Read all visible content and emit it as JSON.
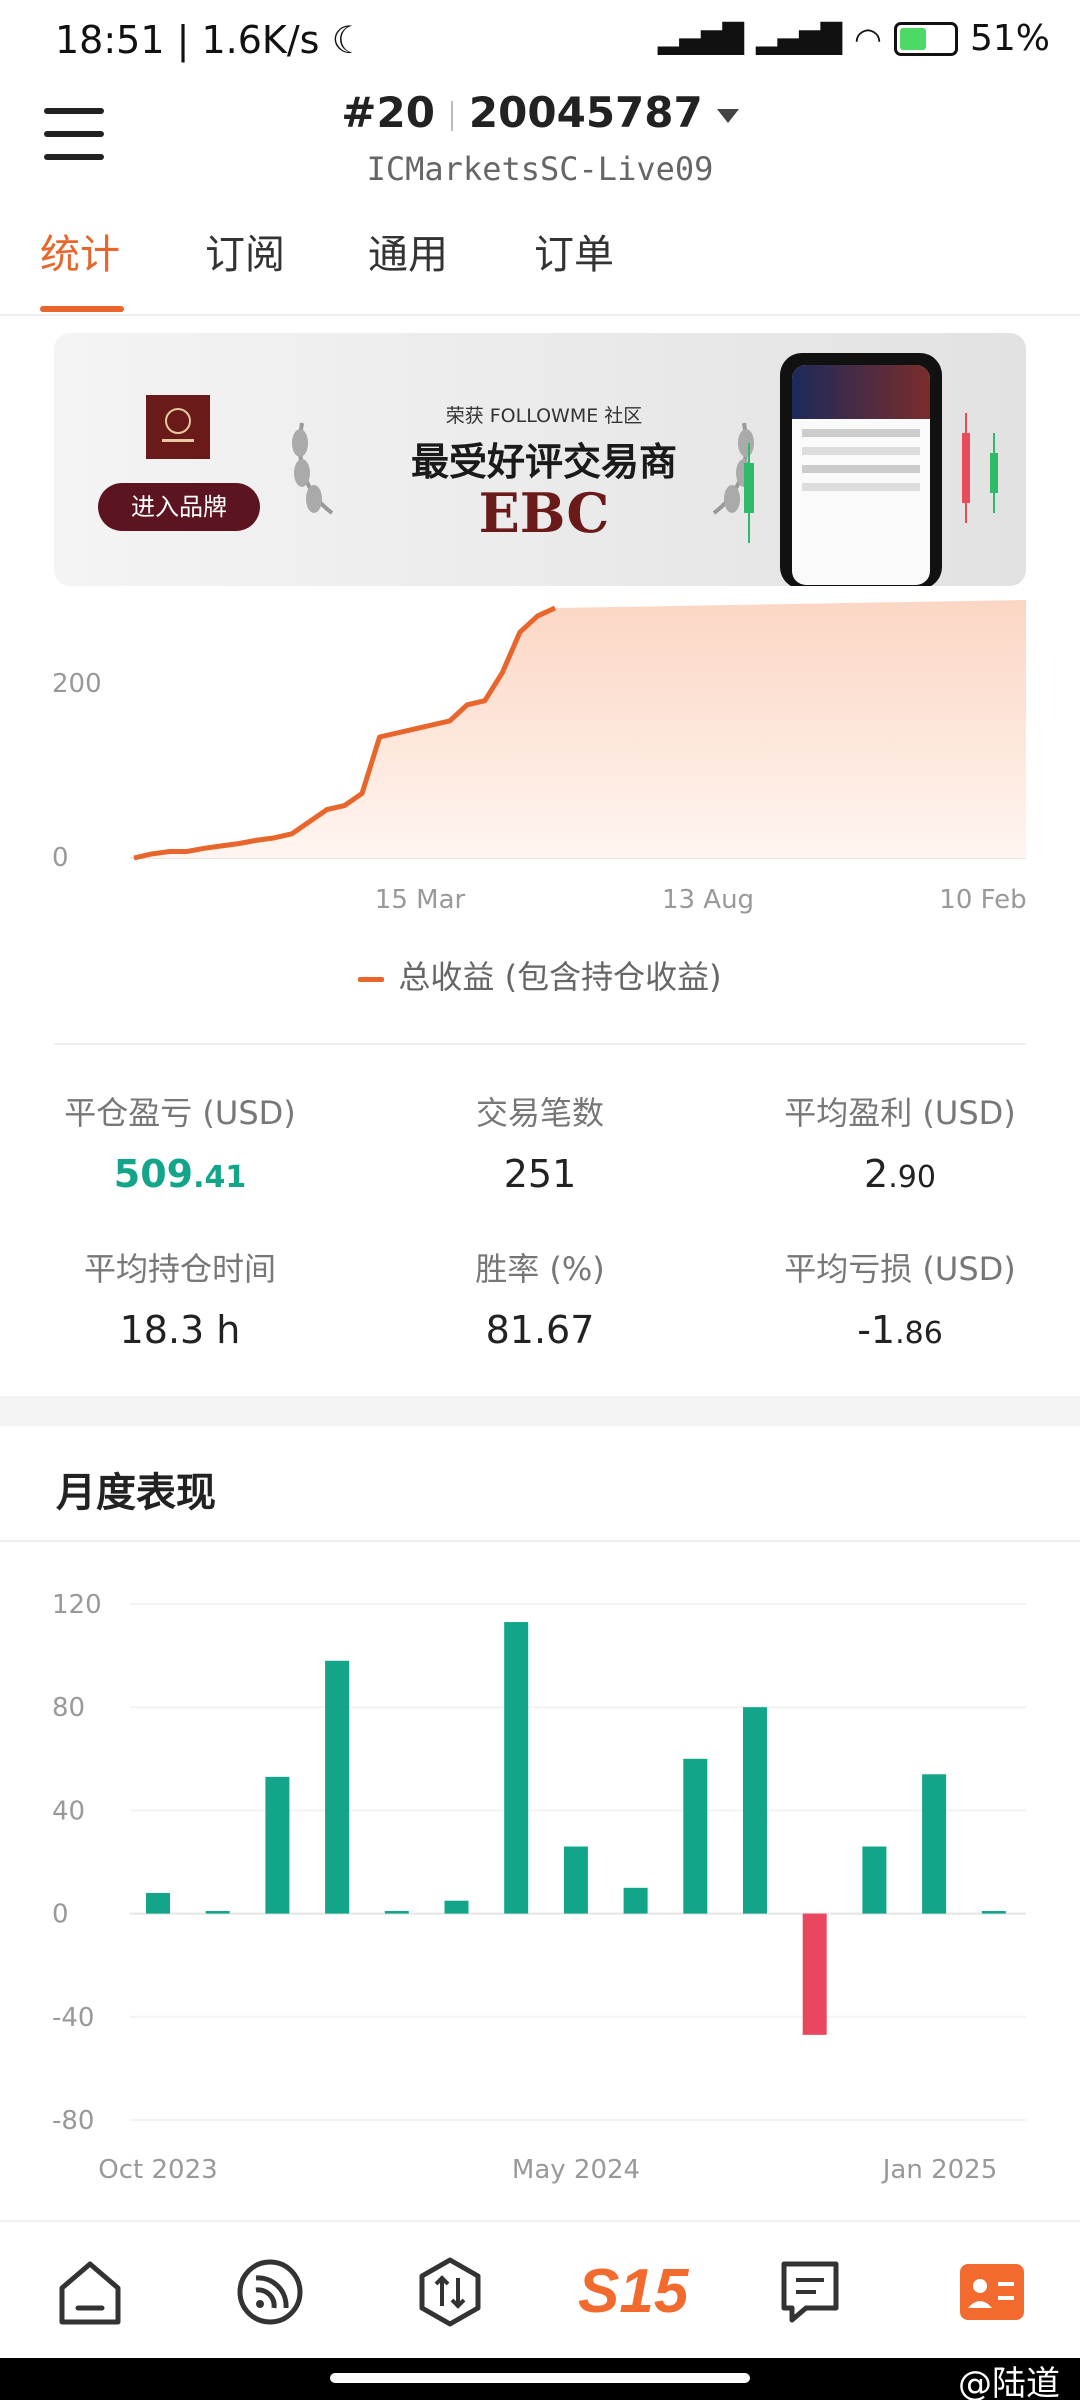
{
  "status_bar": {
    "time": "18:51",
    "speed": "1.6K/s",
    "battery": "51"
  },
  "header": {
    "rank": "#20",
    "account": "20045787",
    "server": "ICMarketsSC-Live09"
  },
  "tabs": [
    "统计",
    "订阅",
    "通用",
    "订单"
  ],
  "banner": {
    "brand_button": "进入品牌",
    "award_line": "荣获 FOLLOWME 社区",
    "award_main": "最受好评交易商",
    "award_brand": "EBC"
  },
  "equity_chart": {
    "y_ticks": [
      "200",
      "0"
    ],
    "x_ticks": [
      "15 Mar",
      "13 Aug",
      "10 Feb"
    ],
    "legend": "总收益 (包含持仓收益)",
    "line_color": "#e8652b",
    "points_y": [
      0,
      5,
      8,
      8,
      12,
      15,
      18,
      22,
      25,
      30,
      45,
      60,
      65,
      80,
      150,
      155,
      160,
      165,
      170,
      190,
      195,
      230,
      280,
      300,
      310
    ]
  },
  "stats": [
    {
      "label": "平仓盈亏 (USD)",
      "value_int": "509",
      "value_dec": ".41",
      "positive": true
    },
    {
      "label": "交易笔数",
      "value_int": "251",
      "value_dec": ""
    },
    {
      "label": "平均盈利 (USD)",
      "value_int": "2",
      "value_dec": ".90"
    },
    {
      "label": "平均持仓时间",
      "value_int": "18.3 h",
      "value_dec": ""
    },
    {
      "label": "胜率 (%)",
      "value_int": "81.67",
      "value_dec": ""
    },
    {
      "label": "平均亏损 (USD)",
      "value_int": "-1",
      "value_dec": ".86"
    }
  ],
  "monthly": {
    "title": "月度表现"
  },
  "chart_data": {
    "type": "bar",
    "title": "月度表现",
    "y_ticks": [
      "120",
      "80",
      "40",
      "0",
      "-40",
      "-80"
    ],
    "ylim": [
      -80,
      120
    ],
    "x_tick_labels": [
      "Oct 2023",
      "May 2024",
      "Jan 2025"
    ],
    "values": [
      8,
      1,
      53,
      98,
      1,
      5,
      113,
      26,
      10,
      60,
      80,
      -47,
      26,
      54,
      1
    ],
    "positive_color": "#12a58a",
    "negative_color": "#e8475f"
  },
  "bottom_nav": [
    "home-icon",
    "feed-icon",
    "trade-icon",
    "s15-logo",
    "message-icon",
    "profile-icon"
  ],
  "nav_logo_text": "S15",
  "watermark": "@陆道"
}
